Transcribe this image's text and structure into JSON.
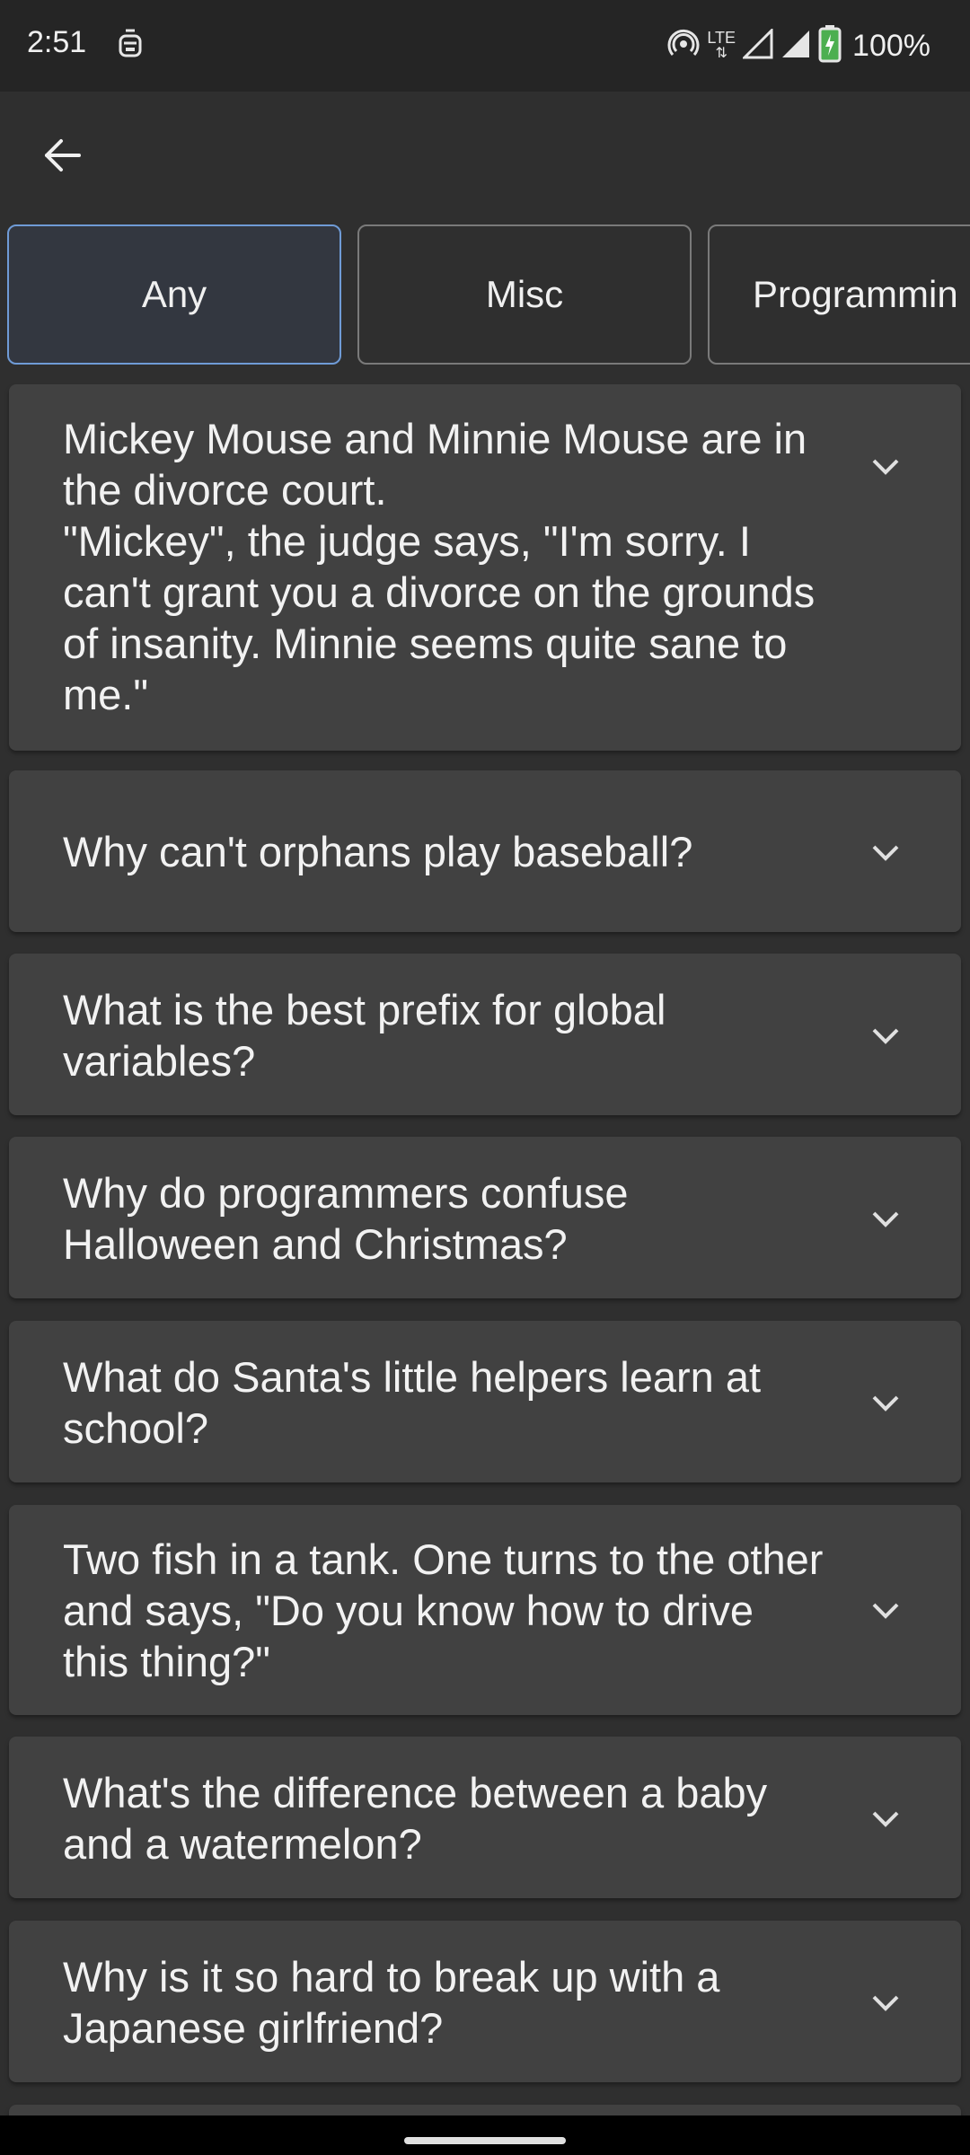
{
  "status_bar": {
    "time": "2:51",
    "network": "LTE",
    "battery": "100%",
    "battery_level": 1.0
  },
  "app_bar": {
    "back_icon": "arrow-left-icon"
  },
  "categories": [
    {
      "label": "Any",
      "selected": true
    },
    {
      "label": "Misc",
      "selected": false
    },
    {
      "label": "Programmin",
      "selected": false
    }
  ],
  "jokes": [
    {
      "text": "Mickey Mouse and Minnie Mouse are in the divorce court.\n\"Mickey\", the judge says, \"I'm sorry. I can't grant you a divorce on the grounds of insanity. Minnie seems quite sane to me.\""
    },
    {
      "text": "Why can't orphans play baseball?"
    },
    {
      "text": "What is the best prefix for global variables?"
    },
    {
      "text": "Why do programmers confuse Halloween and Christmas?"
    },
    {
      "text": "What do Santa's little helpers learn at school?"
    },
    {
      "text": "Two fish in a tank. One turns to the other and says, \"Do you know how to drive this thing?\""
    },
    {
      "text": "What's the difference between a baby and a watermelon?"
    },
    {
      "text": "Why is it so hard to break up with a Japanese girlfriend?"
    }
  ],
  "colors": {
    "background": "#2f2f2f",
    "card": "#414141",
    "selected_chip_border": "#6f9bd6",
    "status_bar": "#252525"
  }
}
